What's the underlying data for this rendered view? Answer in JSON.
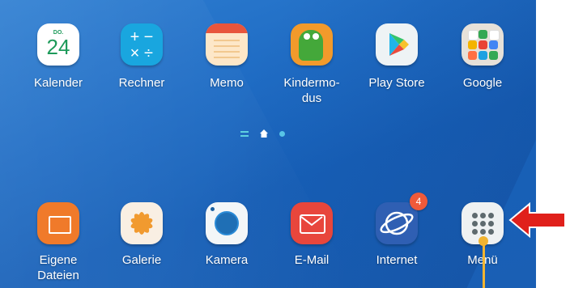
{
  "row1": [
    {
      "key": "calendar",
      "label": "Kalender",
      "dow": "DO.",
      "day": "24"
    },
    {
      "key": "calculator",
      "label": "Rechner"
    },
    {
      "key": "memo",
      "label": "Memo"
    },
    {
      "key": "kids",
      "label": "Kindermo-\ndus"
    },
    {
      "key": "playstore",
      "label": "Play Store"
    },
    {
      "key": "google",
      "label": "Google"
    }
  ],
  "row2": [
    {
      "key": "files",
      "label": "Eigene\nDateien"
    },
    {
      "key": "gallery",
      "label": "Galerie"
    },
    {
      "key": "camera",
      "label": "Kamera"
    },
    {
      "key": "email",
      "label": "E-Mail"
    },
    {
      "key": "internet",
      "label": "Internet",
      "badge": "4"
    },
    {
      "key": "menu",
      "label": "Menü"
    }
  ],
  "calc_symbols": [
    "+",
    "−",
    "×",
    "÷"
  ],
  "colors": {
    "background": "#1f6cc4",
    "arrow": "#e0201b",
    "pointer": "#f1b431",
    "badge": "#ef5a3a"
  }
}
